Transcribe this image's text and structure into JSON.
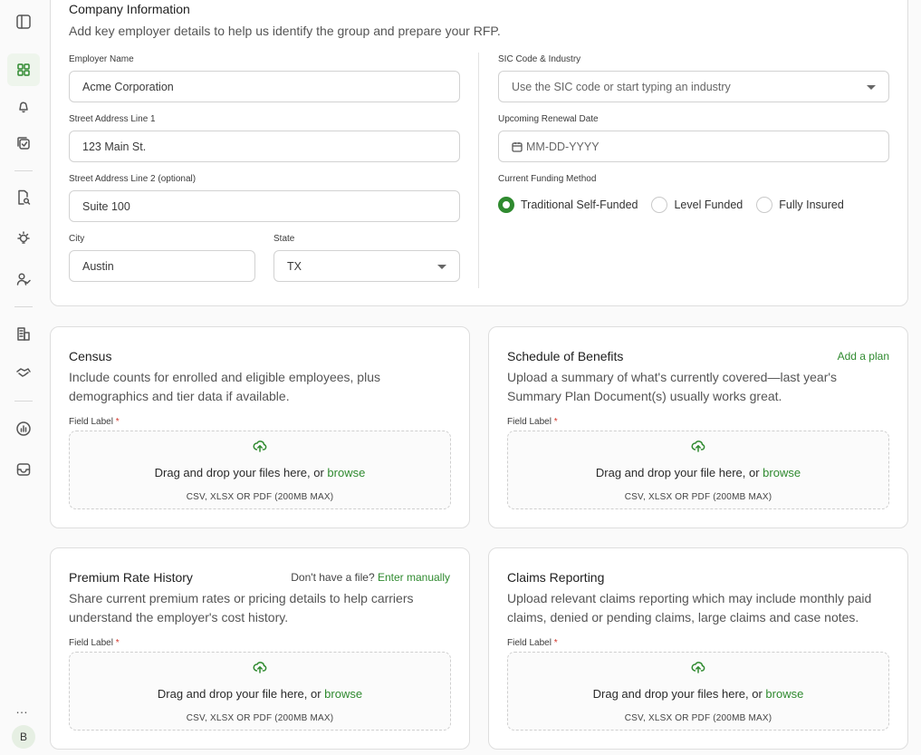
{
  "company": {
    "title": "Company Information",
    "description": "Add key employer details to help us identify the group and prepare your RFP.",
    "employer_name": {
      "label": "Employer Name",
      "value": "Acme Corporation"
    },
    "street1": {
      "label": "Street Address Line 1",
      "value": "123 Main St."
    },
    "street2": {
      "label": "Street Address Line 2 (optional)",
      "value": "Suite 100"
    },
    "city": {
      "label": "City",
      "value": "Austin"
    },
    "state": {
      "label": "State",
      "value": "TX"
    },
    "sic": {
      "label": "SIC Code & Industry",
      "placeholder": "Use the SIC code or start typing an industry"
    },
    "renewal": {
      "label": "Upcoming Renewal Date",
      "placeholder": "MM-DD-YYYY"
    },
    "funding": {
      "label": "Current Funding Method",
      "options": [
        "Traditional Self-Funded",
        "Level Funded",
        "Fully Insured"
      ],
      "selected": "Traditional Self-Funded"
    }
  },
  "upload_hint": "CSV, XLSX OR PDF (200MB MAX)",
  "field_label": "Field Label",
  "required_mark": "*",
  "browse": "browse",
  "census": {
    "title": "Census",
    "description": "Include counts for enrolled and eligible employees, plus demographics and tier data if available.",
    "drop_text": "Drag and drop your files here, or "
  },
  "sob": {
    "title": "Schedule of Benefits",
    "action": "Add a plan",
    "description": "Upload a summary of what's currently covered—last year's Summary Plan Document(s) usually works great.",
    "drop_text": "Drag and drop your file here, or "
  },
  "premium": {
    "title": "Premium Rate History",
    "question": "Don't have a file? ",
    "action": "Enter manually",
    "description": "Share current premium rates or pricing details to help carriers understand the employer's cost history.",
    "drop_text": "Drag and drop your file here, or "
  },
  "claims": {
    "title": "Claims Reporting",
    "description": "Upload relevant claims reporting which may include monthly paid claims, denied or pending claims, large claims and case notes.",
    "drop_text": "Drag and drop your files here, or "
  },
  "sidebar": {
    "icons": [
      "panel-toggle-icon",
      "dashboard-grid-icon",
      "bell-icon",
      "tasks-icon",
      "document-search-icon",
      "lightbulb-icon",
      "users-icon",
      "building-icon",
      "handshake-icon",
      "analytics-icon",
      "inbox-icon"
    ],
    "more": "…",
    "avatar_initial": "B"
  },
  "colors": {
    "accent": "#2f8a2f",
    "required": "#d2362b"
  }
}
